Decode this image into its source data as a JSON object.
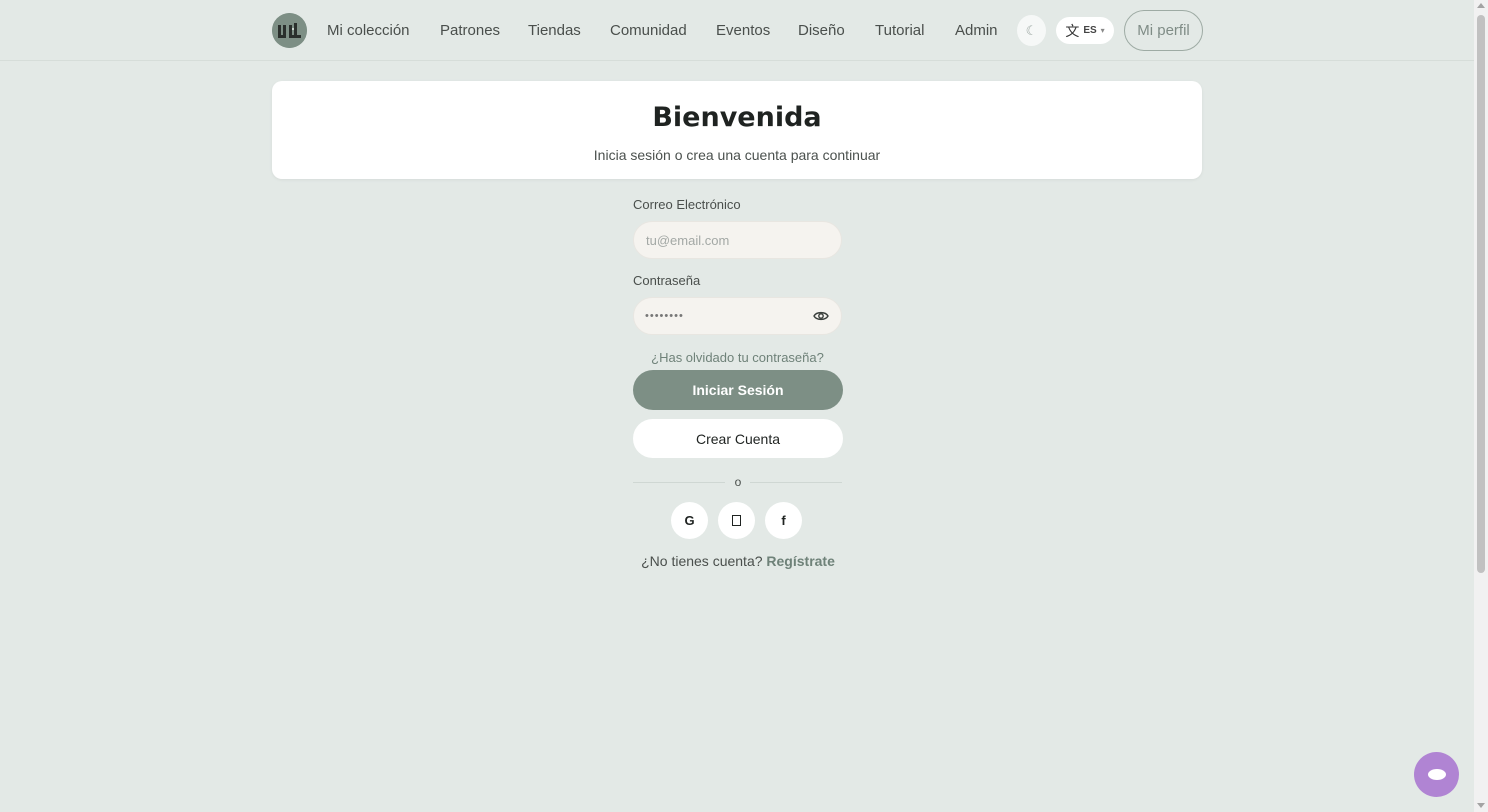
{
  "nav": {
    "items": [
      {
        "label": "Mi colección"
      },
      {
        "label": "Patrones"
      },
      {
        "label": "Tiendas"
      },
      {
        "label": "Comunidad"
      },
      {
        "label": "Eventos"
      },
      {
        "label": "Diseño"
      },
      {
        "label": "Tutorial"
      },
      {
        "label": "Admin"
      }
    ],
    "theme_icon": "☾",
    "language": {
      "glyph": "文",
      "code": "ES",
      "caret": "▾"
    },
    "profile_label": "Mi perfil"
  },
  "welcome": {
    "title": "Bienvenida",
    "subtitle": "Inicia sesión o crea una cuenta para continuar"
  },
  "form": {
    "email_label": "Correo Electrónico",
    "email_placeholder": "tu@email.com",
    "email_value": "",
    "password_label": "Contraseña",
    "password_mask": "••••••••",
    "forgot_password": "¿Has olvidado tu contraseña?",
    "login_button": "Iniciar Sesión",
    "create_account_button": "Crear Cuenta",
    "divider_text": "o",
    "social": [
      {
        "icon": "google-icon",
        "glyph": "G"
      },
      {
        "icon": "apple-icon",
        "glyph": ""
      },
      {
        "icon": "facebook-icon",
        "glyph": "f"
      }
    ],
    "signup_prompt": "¿No tienes cuenta?",
    "signup_link": "Regístrate"
  },
  "colors": {
    "background": "#e3e9e6",
    "accent": "#7d8f85",
    "chat": "#b084d3"
  }
}
